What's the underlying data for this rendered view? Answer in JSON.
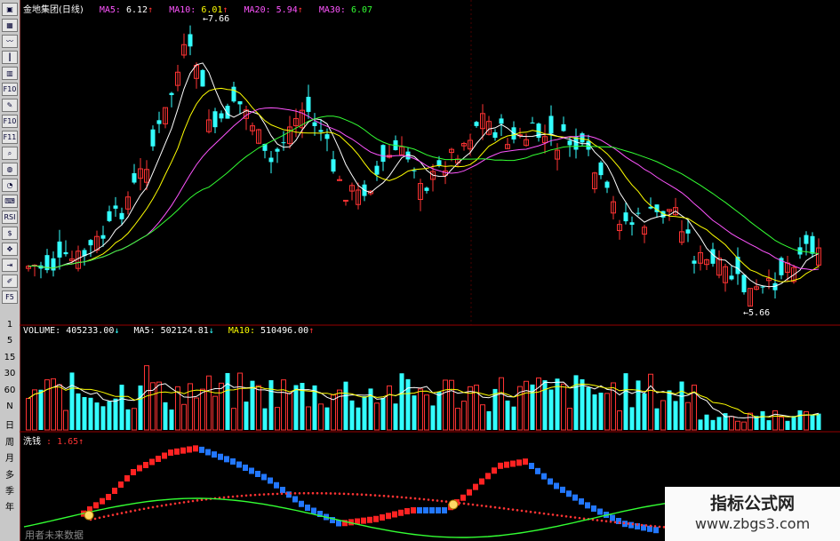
{
  "main_panel": {
    "stock_title": "金地集团(日线)",
    "ma5_label": "MA5:",
    "ma5_value": "6.12",
    "ma10_label": "MA10:",
    "ma10_value": "6.01",
    "ma20_label": "MA20:",
    "ma20_value": "5.94",
    "ma30_label": "MA30:",
    "ma30_value": "6.07",
    "high_marker": "7.66",
    "low_marker": "5.66"
  },
  "volume_panel": {
    "volume_label": "VOLUME:",
    "volume_value": "405233.00",
    "ma5_label": "MA5:",
    "ma5_value": "502124.81",
    "ma10_label": "MA10:",
    "ma10_value": "510496.00"
  },
  "indicator_panel": {
    "name": "洗钱",
    "value": ": 1.65"
  },
  "toolbar": {
    "icons": [
      "window-icon",
      "grid-icon",
      "line-chart-icon",
      "candle-icon",
      "bar-chart-icon",
      "f10-icon",
      "notes-icon",
      "f10-alt-icon",
      "f11-icon",
      "magnify-icon",
      "globe-icon",
      "pie-icon",
      "keyboard-icon",
      "rsi-icon",
      "dollar-icon",
      "move-icon",
      "export-icon",
      "pen-icon",
      "f5-icon"
    ],
    "labels": [
      "1",
      "5",
      "15",
      "30",
      "60",
      "N",
      "日",
      "周",
      "月",
      "多",
      "季",
      "年"
    ]
  },
  "watermark": {
    "title": "指标公式网",
    "url": "www.zbgs3.com"
  },
  "footer_text": "用者未来数据",
  "colors": {
    "up": "#ff3333",
    "down": "#33ffff",
    "ma5": "#ffffff",
    "ma10": "#ffff00",
    "ma20": "#ff55ff",
    "ma30": "#33ff33",
    "grid": "#990000"
  }
}
